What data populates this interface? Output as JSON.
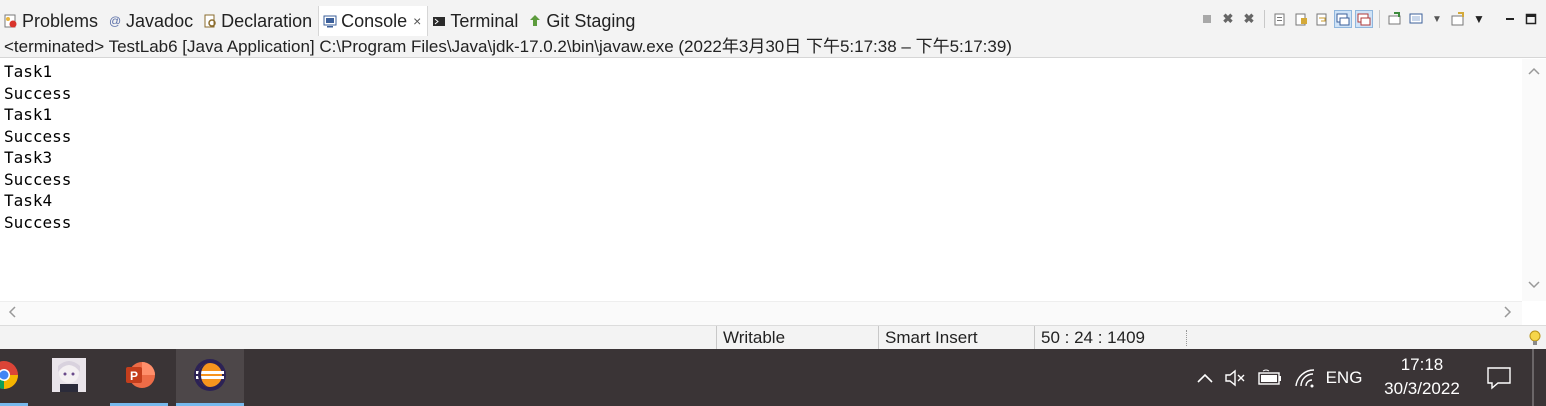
{
  "tabs": [
    {
      "label": "Problems",
      "icon": "problems-icon",
      "active": false
    },
    {
      "label": "Javadoc",
      "icon": "javadoc-icon",
      "active": false
    },
    {
      "label": "Declaration",
      "icon": "declaration-icon",
      "active": false
    },
    {
      "label": "Console",
      "icon": "console-icon",
      "active": true,
      "close": "×"
    },
    {
      "label": "Terminal",
      "icon": "terminal-icon",
      "active": false
    },
    {
      "label": "Git Staging",
      "icon": "git-staging-icon",
      "active": false
    }
  ],
  "toolbar": {
    "buttons": [
      "terminate-icon",
      "remove-launch-icon",
      "remove-all-terminated-icon",
      "clear-console-icon",
      "scroll-lock-icon",
      "word-wrap-icon",
      "show-on-stdout-icon",
      "show-on-stderr-icon",
      "pin-console-icon",
      "display-selected-console-icon",
      "open-console-icon",
      "view-menu-icon",
      "minimize-icon",
      "maximize-icon"
    ],
    "selected": [
      "show-on-stdout-icon",
      "show-on-stderr-icon"
    ]
  },
  "header": {
    "text": "<terminated> TestLab6 [Java Application] C:\\Program Files\\Java\\jdk-17.0.2\\bin\\javaw.exe  (2022年3月30日 下午5:17:38 – 下午5:17:39)"
  },
  "console": {
    "lines": [
      "Task1",
      "Success",
      "Task1",
      "Success",
      "Task3",
      "Success",
      "Task4",
      "Success"
    ]
  },
  "status": {
    "writable": "Writable",
    "insert_mode": "Smart Insert",
    "position": "50 : 24 : 1409"
  },
  "taskbar": {
    "apps": [
      "chrome-icon",
      "anime-avatar-icon",
      "powerpoint-icon",
      "eclipse-icon"
    ],
    "active_app": "eclipse-icon",
    "tray": {
      "language": "ENG",
      "time": "17:18",
      "date": "30/3/2022"
    }
  },
  "colors": {
    "taskbar": "#3a3436",
    "accent": "#76b9ed",
    "panel": "#f3f3f3"
  }
}
